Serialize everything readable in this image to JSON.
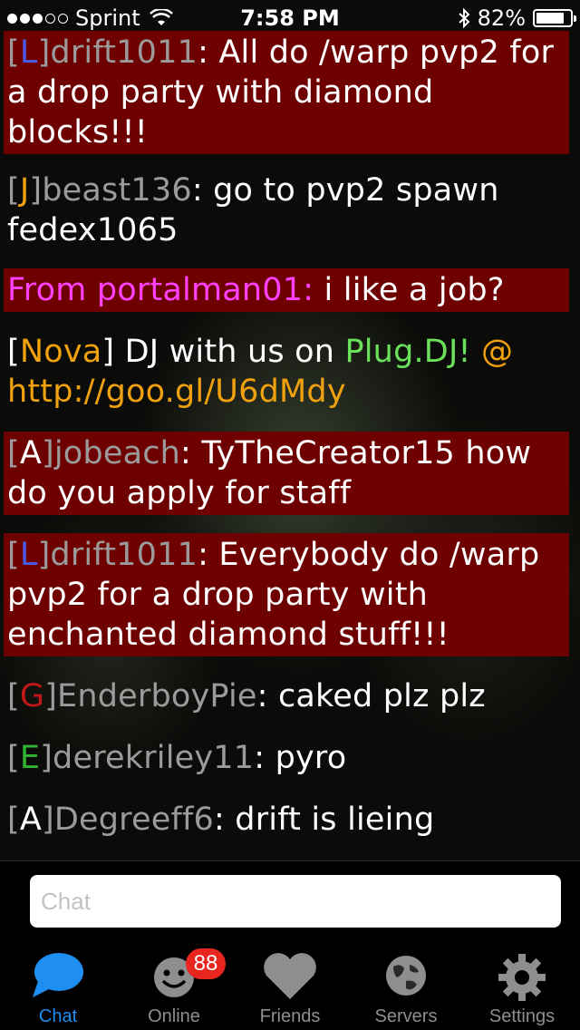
{
  "status_bar": {
    "carrier": "Sprint",
    "time": "7:58 PM",
    "battery": "82%",
    "battery_level": 0.82
  },
  "messages": [
    {
      "open": "[",
      "rank": "L",
      "close": "]",
      "name": "drift1011",
      "text": ": All do /warp pvp2 for a drop party with diamond blocks!!!"
    },
    {
      "open": "[",
      "rank": "J",
      "close": "]",
      "name": "beast136",
      "text": ": go to pvp2 spawn fedex1065"
    },
    {
      "from": "From portalman01:",
      "text": " i like a job?"
    },
    {
      "open": "[",
      "tag": "Nova",
      "close": "]",
      "text": " DJ with us on ",
      "link_label": "Plug.DJ!",
      "at": " @",
      "url": "http://goo.gl/U6dMdy"
    },
    {
      "open": "[",
      "rank": "A",
      "close": "]",
      "name": "jobeach",
      "text": ": TyTheCreator15 how do you apply for staff"
    },
    {
      "open": "[",
      "rank": "L",
      "close": "]",
      "name": "drift1011",
      "text": ": Everybody do /warp pvp2 for a drop party with enchanted diamond stuff!!!"
    },
    {
      "open": "[",
      "rank": "G",
      "close": "]",
      "name": "EnderboyPie",
      "text": ": caked plz plz"
    },
    {
      "open": "[",
      "rank": "E",
      "close": "]",
      "name": "derekriley11",
      "text": ": pyro"
    },
    {
      "open": "[",
      "rank": "A",
      "close": "]",
      "name": "Degreeff6",
      "text": ": drift is lieing"
    }
  ],
  "input": {
    "placeholder": "Chat"
  },
  "tabs": [
    {
      "label": "Chat",
      "icon": "chat-bubble-icon"
    },
    {
      "label": "Online",
      "icon": "smiley-icon",
      "badge": "88"
    },
    {
      "label": "Friends",
      "icon": "heart-icon"
    },
    {
      "label": "Servers",
      "icon": "globe-icon"
    },
    {
      "label": "Settings",
      "icon": "gear-icon"
    }
  ],
  "colors": {
    "highlight_bg": "#6e0000",
    "accent": "#1e8ef2",
    "badge": "#e8261f",
    "whisper": "#ff40ff",
    "link": "#f0a10d"
  }
}
